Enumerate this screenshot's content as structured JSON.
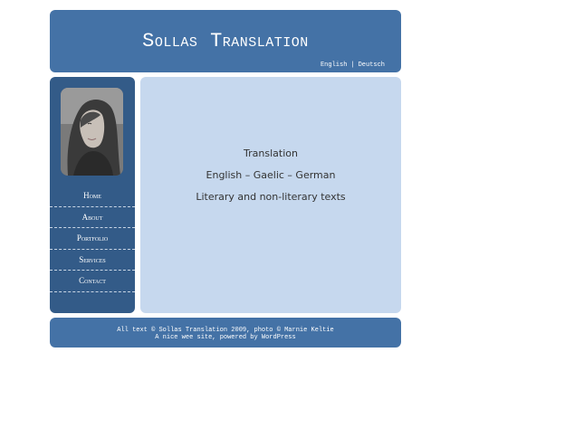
{
  "header": {
    "site_title": "Sollas Translation",
    "languages": [
      {
        "label": "English"
      },
      {
        "label": "Deutsch"
      }
    ],
    "separator": "|"
  },
  "sidebar": {
    "nav": [
      {
        "label": "Home"
      },
      {
        "label": "About"
      },
      {
        "label": "Portfolio"
      },
      {
        "label": "Services"
      },
      {
        "label": "Contact"
      }
    ]
  },
  "main": {
    "lines": [
      "Translation",
      "English – Gaelic – German",
      "Literary and non-literary texts"
    ]
  },
  "footer": {
    "line1": "All text © Sollas Translation 2009, photo © Marnie Keltie",
    "line2": "A nice wee site, powered by WordPress"
  },
  "colors": {
    "header_bg": "#4472a6",
    "sidebar_bg": "#335b88",
    "content_bg": "#c6d8ee"
  }
}
